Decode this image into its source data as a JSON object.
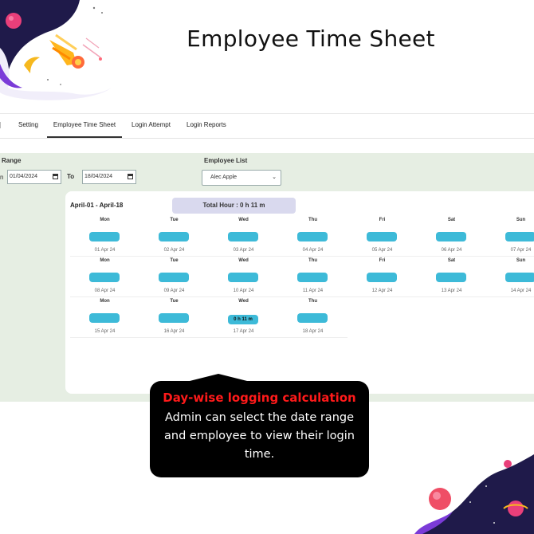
{
  "page": {
    "title": "Employee Time Sheet"
  },
  "tabs": [
    {
      "label": "Setting"
    },
    {
      "label": "Employee Time Sheet",
      "active": true
    },
    {
      "label": "Login Attempt"
    },
    {
      "label": "Login Reports"
    }
  ],
  "filters": {
    "range_label": "Range",
    "from_prefix": "n",
    "from_value": "01/04/2024",
    "to_label": "To",
    "to_value": "18/04/2024",
    "employee_label": "Employee List",
    "employee_value": "Alec Apple"
  },
  "timesheet": {
    "range_title": "April-01 - April-18",
    "total_hours": "Total Hour : 0 h 11 m",
    "accent": "#3dbad8",
    "weeks": [
      [
        {
          "day": "Mon",
          "date": "01 Apr 24",
          "time": ""
        },
        {
          "day": "Tue",
          "date": "02 Apr 24",
          "time": ""
        },
        {
          "day": "Wed",
          "date": "03 Apr 24",
          "time": ""
        },
        {
          "day": "Thu",
          "date": "04 Apr 24",
          "time": ""
        },
        {
          "day": "Fri",
          "date": "05 Apr 24",
          "time": ""
        },
        {
          "day": "Sat",
          "date": "06 Apr 24",
          "time": ""
        },
        {
          "day": "Sun",
          "date": "07 Apr 24",
          "time": ""
        }
      ],
      [
        {
          "day": "Mon",
          "date": "08 Apr 24",
          "time": ""
        },
        {
          "day": "Tue",
          "date": "09 Apr 24",
          "time": ""
        },
        {
          "day": "Wed",
          "date": "10 Apr 24",
          "time": ""
        },
        {
          "day": "Thu",
          "date": "11 Apr 24",
          "time": ""
        },
        {
          "day": "Fri",
          "date": "12 Apr 24",
          "time": ""
        },
        {
          "day": "Sat",
          "date": "13 Apr 24",
          "time": ""
        },
        {
          "day": "Sun",
          "date": "14 Apr 24",
          "time": ""
        }
      ],
      [
        {
          "day": "Mon",
          "date": "15 Apr 24",
          "time": ""
        },
        {
          "day": "Tue",
          "date": "16 Apr 24",
          "time": ""
        },
        {
          "day": "Wed",
          "date": "17 Apr 24",
          "time": "0 h 11 m"
        },
        {
          "day": "Thu",
          "date": "18 Apr 24",
          "time": ""
        }
      ]
    ]
  },
  "callout": {
    "heading": "Day-wise logging calculation",
    "body": "Admin can select the date range and employee to view their login time.",
    "heading_color": "#ff1a1a"
  }
}
